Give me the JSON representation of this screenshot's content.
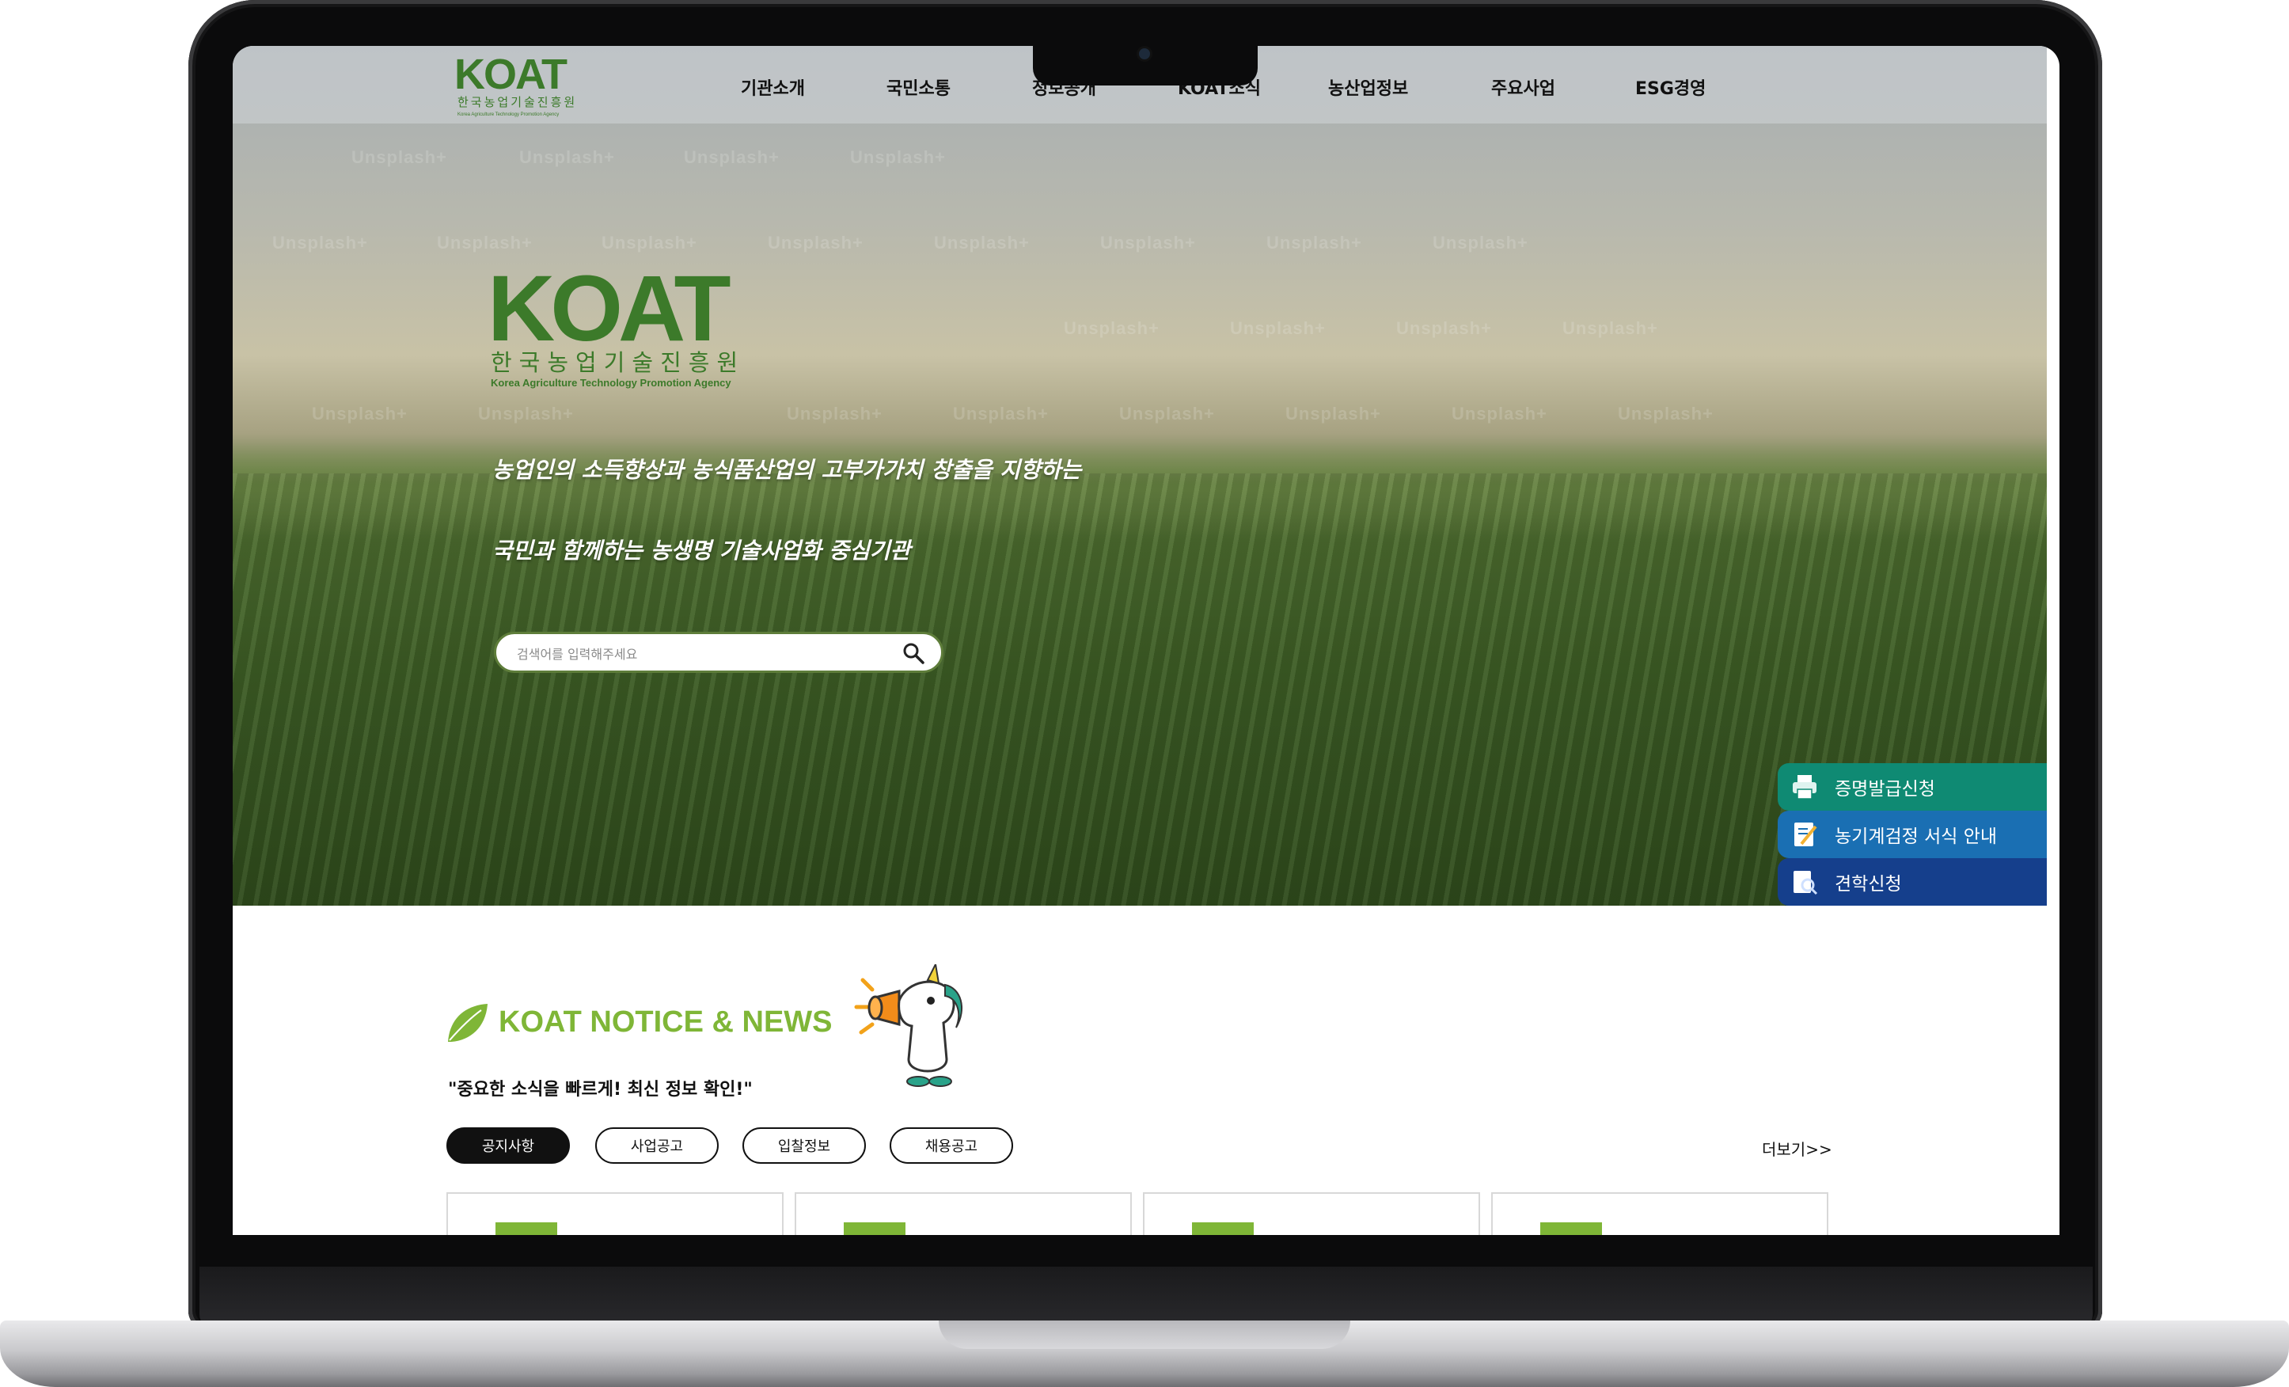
{
  "nav": {
    "items": [
      "기관소개",
      "국민소통",
      "정보공개",
      "KOAT소식",
      "농산업정보",
      "주요사업",
      "ESG경영"
    ]
  },
  "logo": {
    "text": "KOAT",
    "korean_name": "한국농업기술진흥원",
    "english_name": "Korea Agriculture Technology Promotion Agency"
  },
  "hero": {
    "watermark": "Unsplash+",
    "tagline_line1": "농업인의 소득향상과 농식품산업의 고부가가치 창출을 지향하는",
    "tagline_line2": "국민과 함께하는 농생명 기술사업화 중심기관"
  },
  "search": {
    "placeholder": "검색어를 입력해주세요",
    "icon": "search-icon"
  },
  "quick_links": [
    {
      "label": "증명발급신청",
      "icon": "printer-icon",
      "color": "#0f8a73"
    },
    {
      "label": "농기계검정 서식 안내",
      "icon": "document-edit-icon",
      "color": "#1a6fb3"
    },
    {
      "label": "견학신청",
      "icon": "search-document-icon",
      "color": "#153f8c"
    }
  ],
  "notice": {
    "title": "KOAT NOTICE & NEWS",
    "subtitle": "\"중요한 소식을 빠르게! 최신 정보 확인!\"",
    "tabs": [
      "공지사항",
      "사업공고",
      "입찰정보",
      "채용공고"
    ],
    "active_tab": "공지사항",
    "more_label": "더보기>>",
    "accent_color": "#7fb637"
  }
}
